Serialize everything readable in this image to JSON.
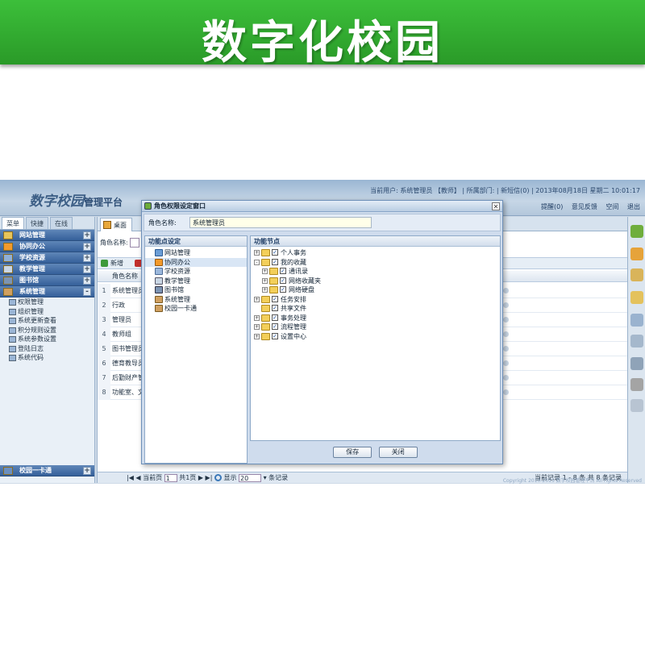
{
  "banner": {
    "title": "数字化校园"
  },
  "app": {
    "logo_main": "数字校园",
    "logo_sub": "管理平台",
    "user_line": "当前用户: 系统管理员 【教师】 | 所属部门: | 新短信(0) | 2013年08月18日 星期二 10:01:17",
    "toolbar": {
      "remind": "提醒(0)",
      "feedback": "意见反馈",
      "help": "空间",
      "exit": "退出"
    },
    "footer": "Copyright 2010-2015 数字校园管理平台 All rights Reserved"
  },
  "sidebar": {
    "tabs": [
      "菜单",
      "快捷",
      "在线"
    ],
    "groups": [
      "网站管理",
      "协同办公",
      "学校资源",
      "教学管理",
      "图书馆",
      "系统管理"
    ],
    "sub_items": [
      "权限管理",
      "组织管理",
      "系统更新查看",
      "积分规则设置",
      "系统参数设置",
      "登陆日志",
      "系统代码"
    ],
    "bottom_group": "校园一卡通"
  },
  "main": {
    "tab_label": "桌面",
    "search_label": "角色名称:",
    "toolbar": {
      "add": "新增",
      "delete": "删除"
    },
    "column_header": "角色名称",
    "rows": [
      {
        "n": "1",
        "name": "系统管理员"
      },
      {
        "n": "2",
        "name": "行政"
      },
      {
        "n": "3",
        "name": "管理员"
      },
      {
        "n": "4",
        "name": "教师组"
      },
      {
        "n": "5",
        "name": "图书管理员"
      },
      {
        "n": "6",
        "name": "德育教导员"
      },
      {
        "n": "7",
        "name": "后勤财产管"
      },
      {
        "n": "8",
        "name": "功能室、文"
      }
    ],
    "pager": {
      "current_label": "当前页",
      "current_value": "1",
      "total_label": "共1页",
      "show_label": "显示",
      "page_size": "20",
      "records_label": "条记录",
      "summary": "当前记录 1 - 8 条 共 8 条记录"
    }
  },
  "modal": {
    "title": "角色权限设定窗口",
    "name_label": "角色名称:",
    "name_value": "系统管理员",
    "left_head": "功能点设定",
    "right_head": "功能节点",
    "functions": [
      "网站管理",
      "协同办公",
      "学校资源",
      "教学管理",
      "图书馆",
      "系统管理",
      "校园一卡通"
    ],
    "tree": [
      {
        "label": "个人事务",
        "level": 0,
        "toggle": "+"
      },
      {
        "label": "我的收藏",
        "level": 0,
        "toggle": "-"
      },
      {
        "label": "通讯录",
        "level": 1,
        "toggle": "+"
      },
      {
        "label": "网络收藏夹",
        "level": 1,
        "toggle": "+"
      },
      {
        "label": "网络硬盘",
        "level": 1,
        "toggle": "+"
      },
      {
        "label": "任务安排",
        "level": 0,
        "toggle": "+"
      },
      {
        "label": "共享文件",
        "level": 0,
        "toggle": ""
      },
      {
        "label": "事务处理",
        "level": 0,
        "toggle": "+"
      },
      {
        "label": "流程管理",
        "level": 0,
        "toggle": "+"
      },
      {
        "label": "设置中心",
        "level": 0,
        "toggle": "+"
      }
    ],
    "save_label": "保存",
    "close_label": "关闭"
  },
  "colors": {
    "banner_green": "#2ea72c",
    "nav_blue": "#35609a",
    "header_blue": "#9ab6d3"
  }
}
